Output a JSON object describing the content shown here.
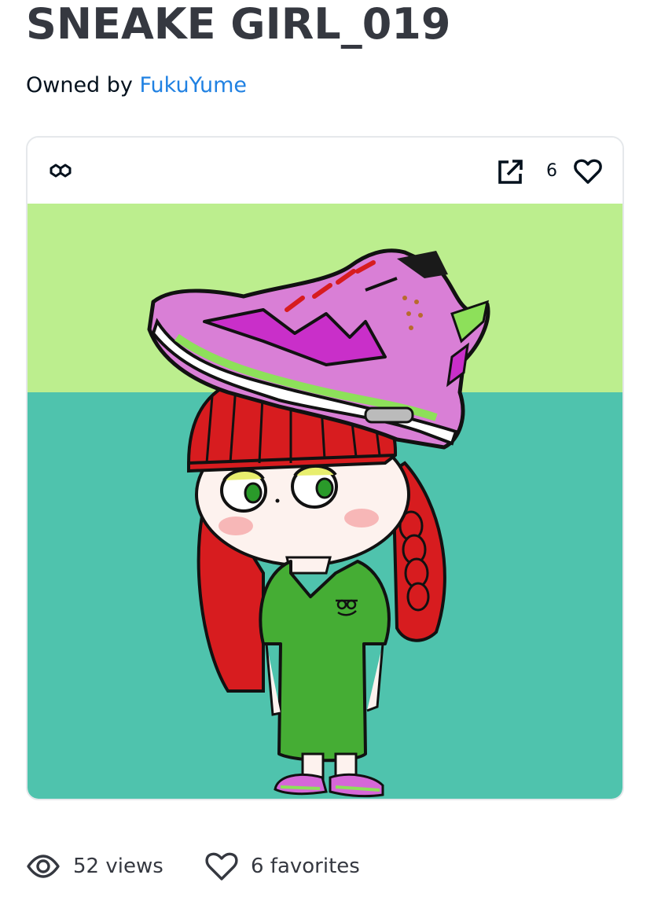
{
  "item": {
    "title": "SNEAKE GIRL_019",
    "owned_by_label": "Owned by",
    "owner_name": "FukuYume"
  },
  "card": {
    "chain_icon": "polygon-chain-icon",
    "external_link_icon": "external-link-icon",
    "favorite_count": "6",
    "favorite_icon": "heart-icon"
  },
  "stats": {
    "views_icon": "eye-icon",
    "views_text": "52 views",
    "favorites_icon": "heart-icon",
    "favorites_text": "6 favorites"
  },
  "colors": {
    "title": "#353840",
    "link": "#2081e2",
    "art_bg_top": "#bcee8e",
    "art_bg_bottom": "#4fc3ad",
    "hair": "#d71c1f",
    "shirt": "#45ad34",
    "sneaker": "#d97fd6"
  }
}
